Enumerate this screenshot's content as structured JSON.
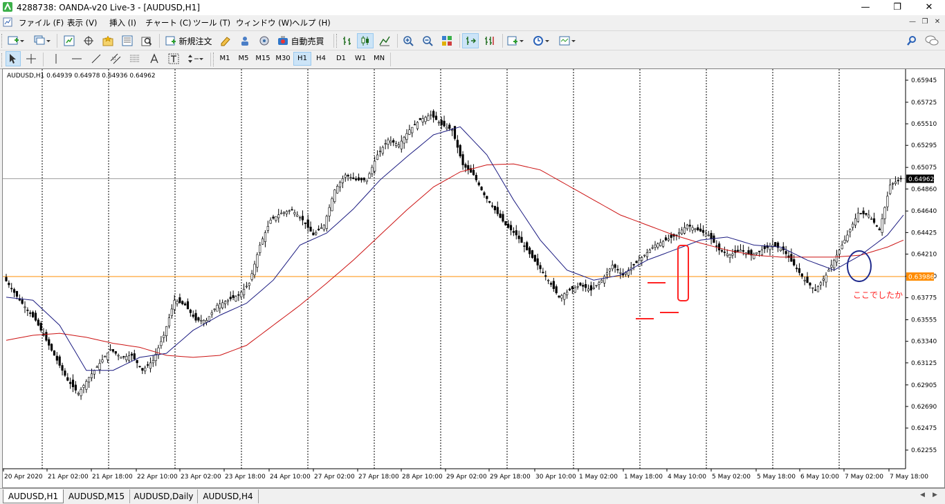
{
  "window": {
    "title": "4288738: OANDA-v20 Live-3 - [AUDUSD,H1]"
  },
  "menu": [
    "ファイル (F)",
    "表示 (V)",
    "挿入 (I)",
    "チャート (C)",
    "ツール (T)",
    "ウィンドウ (W)",
    "ヘルプ (H)"
  ],
  "toolbar": {
    "new_order": "新規注文",
    "auto_trading": "自動売買"
  },
  "timeframes": [
    "M1",
    "M5",
    "M15",
    "M30",
    "H1",
    "H4",
    "D1",
    "W1",
    "MN"
  ],
  "active_timeframe": "H1",
  "tabs": [
    "AUDUSD,H1",
    "AUDUSD,M15",
    "AUDUSD,Daily",
    "AUDUSD,H4"
  ],
  "active_tab": "AUDUSD,H1",
  "colors": {
    "candle": "#000000",
    "ma_fast": "#1a1a80",
    "ma_slow": "#cc1111",
    "current_price_line": "#a0a0a0",
    "horizontal_line": "#ff8c00",
    "annotation": "#ff2222",
    "annotation_circle": "#1f2a8c"
  },
  "chart_data": {
    "type": "candlestick",
    "symbol_info": "AUDUSD,H1  0.64939 0.64978 0.64936 0.64962",
    "y_ticks": [
      "0.65945",
      "0.65725",
      "0.65510",
      "0.65295",
      "0.65075",
      "0.64860",
      "0.64640",
      "0.64425",
      "0.64210",
      "0.63990",
      "0.63775",
      "0.63555",
      "0.63340",
      "0.63125",
      "0.62905",
      "0.62690",
      "0.62475",
      "0.62255"
    ],
    "ylim": [
      0.62255,
      0.65945
    ],
    "x_labels": [
      "20 Apr 2020",
      "21 Apr 02:00",
      "21 Apr 18:00",
      "22 Apr 10:00",
      "23 Apr 02:00",
      "23 Apr 18:00",
      "24 Apr 10:00",
      "27 Apr 02:00",
      "27 Apr 18:00",
      "28 Apr 10:00",
      "29 Apr 02:00",
      "29 Apr 18:00",
      "30 Apr 10:00",
      "1 May 02:00",
      "1 May 18:00",
      "4 May 10:00",
      "5 May 02:00",
      "5 May 18:00",
      "6 May 10:00",
      "7 May 02:00",
      "7 May 18:00"
    ],
    "current_price": {
      "value": 0.64962,
      "label": "0.64962"
    },
    "horizontal_line": {
      "value": 0.63986,
      "label": "0.63986"
    },
    "annotation_text": "ここでしたか",
    "close_path": [
      [
        0,
        0.6398
      ],
      [
        6,
        0.6375
      ],
      [
        12,
        0.6355
      ],
      [
        16,
        0.6335
      ],
      [
        20,
        0.6315
      ],
      [
        24,
        0.6295
      ],
      [
        28,
        0.6282
      ],
      [
        32,
        0.6298
      ],
      [
        36,
        0.6312
      ],
      [
        40,
        0.6326
      ],
      [
        44,
        0.6318
      ],
      [
        48,
        0.632
      ],
      [
        52,
        0.6305
      ],
      [
        56,
        0.6315
      ],
      [
        60,
        0.634
      ],
      [
        64,
        0.6375
      ],
      [
        68,
        0.637
      ],
      [
        72,
        0.6355
      ],
      [
        76,
        0.6355
      ],
      [
        80,
        0.637
      ],
      [
        84,
        0.6375
      ],
      [
        88,
        0.638
      ],
      [
        92,
        0.6392
      ],
      [
        96,
        0.643
      ],
      [
        100,
        0.6455
      ],
      [
        104,
        0.6462
      ],
      [
        108,
        0.6465
      ],
      [
        112,
        0.6455
      ],
      [
        116,
        0.644
      ],
      [
        120,
        0.645
      ],
      [
        124,
        0.6485
      ],
      [
        128,
        0.65
      ],
      [
        132,
        0.6495
      ],
      [
        136,
        0.6495
      ],
      [
        140,
        0.652
      ],
      [
        144,
        0.6535
      ],
      [
        148,
        0.653
      ],
      [
        152,
        0.6545
      ],
      [
        156,
        0.6555
      ],
      [
        160,
        0.656
      ],
      [
        164,
        0.655
      ],
      [
        168,
        0.6545
      ],
      [
        172,
        0.651
      ],
      [
        176,
        0.65
      ],
      [
        180,
        0.648
      ],
      [
        184,
        0.6465
      ],
      [
        188,
        0.645
      ],
      [
        192,
        0.644
      ],
      [
        196,
        0.6425
      ],
      [
        200,
        0.641
      ],
      [
        204,
        0.6395
      ],
      [
        208,
        0.6378
      ],
      [
        212,
        0.6385
      ],
      [
        216,
        0.639
      ],
      [
        220,
        0.6385
      ],
      [
        224,
        0.6395
      ],
      [
        228,
        0.641
      ],
      [
        232,
        0.64
      ],
      [
        236,
        0.641
      ],
      [
        240,
        0.642
      ],
      [
        244,
        0.643
      ],
      [
        248,
        0.6435
      ],
      [
        252,
        0.644
      ],
      [
        256,
        0.645
      ],
      [
        260,
        0.6445
      ],
      [
        264,
        0.644
      ],
      [
        268,
        0.6425
      ],
      [
        272,
        0.642
      ],
      [
        276,
        0.6425
      ],
      [
        280,
        0.642
      ],
      [
        284,
        0.6425
      ],
      [
        288,
        0.643
      ],
      [
        292,
        0.6425
      ],
      [
        296,
        0.641
      ],
      [
        300,
        0.6395
      ],
      [
        304,
        0.6385
      ],
      [
        308,
        0.64
      ],
      [
        312,
        0.642
      ],
      [
        316,
        0.644
      ],
      [
        320,
        0.6462
      ],
      [
        324,
        0.646
      ],
      [
        328,
        0.6445
      ],
      [
        332,
        0.649
      ],
      [
        336,
        0.6496
      ]
    ],
    "ma_fast_path": [
      [
        0,
        0.6378
      ],
      [
        10,
        0.6375
      ],
      [
        20,
        0.635
      ],
      [
        30,
        0.6305
      ],
      [
        40,
        0.6305
      ],
      [
        50,
        0.6318
      ],
      [
        60,
        0.6322
      ],
      [
        70,
        0.6345
      ],
      [
        80,
        0.636
      ],
      [
        90,
        0.6372
      ],
      [
        100,
        0.6395
      ],
      [
        110,
        0.643
      ],
      [
        120,
        0.6442
      ],
      [
        130,
        0.6466
      ],
      [
        140,
        0.6495
      ],
      [
        150,
        0.6518
      ],
      [
        160,
        0.654
      ],
      [
        170,
        0.6548
      ],
      [
        180,
        0.652
      ],
      [
        190,
        0.6475
      ],
      [
        200,
        0.6435
      ],
      [
        210,
        0.6405
      ],
      [
        220,
        0.6395
      ],
      [
        230,
        0.64
      ],
      [
        240,
        0.6415
      ],
      [
        250,
        0.6425
      ],
      [
        260,
        0.6435
      ],
      [
        270,
        0.6438
      ],
      [
        280,
        0.643
      ],
      [
        290,
        0.6428
      ],
      [
        300,
        0.6415
      ],
      [
        310,
        0.6405
      ],
      [
        320,
        0.642
      ],
      [
        330,
        0.644
      ],
      [
        336,
        0.646
      ]
    ],
    "ma_slow_path": [
      [
        0,
        0.6335
      ],
      [
        10,
        0.634
      ],
      [
        20,
        0.6342
      ],
      [
        30,
        0.6338
      ],
      [
        40,
        0.6332
      ],
      [
        50,
        0.6328
      ],
      [
        60,
        0.632
      ],
      [
        70,
        0.6318
      ],
      [
        80,
        0.632
      ],
      [
        90,
        0.633
      ],
      [
        100,
        0.635
      ],
      [
        110,
        0.637
      ],
      [
        120,
        0.6392
      ],
      [
        130,
        0.6415
      ],
      [
        140,
        0.644
      ],
      [
        150,
        0.6465
      ],
      [
        160,
        0.6488
      ],
      [
        170,
        0.6503
      ],
      [
        180,
        0.651
      ],
      [
        190,
        0.6511
      ],
      [
        200,
        0.6505
      ],
      [
        210,
        0.649
      ],
      [
        220,
        0.6475
      ],
      [
        230,
        0.646
      ],
      [
        240,
        0.645
      ],
      [
        250,
        0.644
      ],
      [
        260,
        0.6432
      ],
      [
        270,
        0.6425
      ],
      [
        280,
        0.642
      ],
      [
        290,
        0.6418
      ],
      [
        300,
        0.6418
      ],
      [
        310,
        0.6418
      ],
      [
        320,
        0.642
      ],
      [
        330,
        0.6428
      ],
      [
        336,
        0.6435
      ]
    ]
  }
}
